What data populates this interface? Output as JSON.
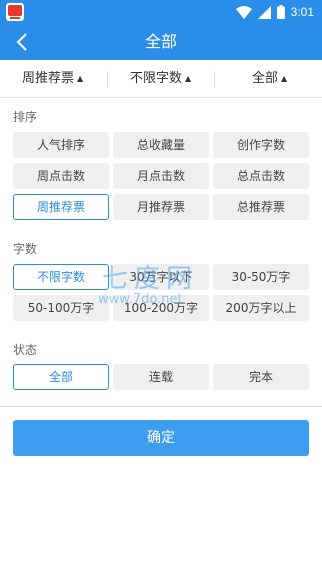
{
  "status_bar": {
    "time": "3:01"
  },
  "header": {
    "title": "全部"
  },
  "filter_bar": {
    "tabs": [
      {
        "label": "周推荐票",
        "arrow": "▲"
      },
      {
        "label": "不限字数",
        "arrow": "▲"
      },
      {
        "label": "全部",
        "arrow": "▲"
      }
    ]
  },
  "sort": {
    "title": "排序",
    "options": [
      "人气排序",
      "总收藏量",
      "创作字数",
      "周点击数",
      "月点击数",
      "总点击数",
      "周推荐票",
      "月推荐票",
      "总推荐票"
    ],
    "selected": "周推荐票"
  },
  "word_count": {
    "title": "字数",
    "options": [
      "不限字数",
      "30万字以下",
      "30-50万字",
      "50-100万字",
      "100-200万字",
      "200万字以上"
    ],
    "selected": "不限字数"
  },
  "status": {
    "title": "状态",
    "options": [
      "全部",
      "连载",
      "完本"
    ],
    "selected": "全部"
  },
  "confirm": {
    "label": "确定"
  },
  "watermark": {
    "text": "七度网",
    "url": "www.7do.net"
  },
  "colors": {
    "primary": "#2a8ee8",
    "button": "#3d9ef0",
    "chip_bg": "#efefef"
  }
}
